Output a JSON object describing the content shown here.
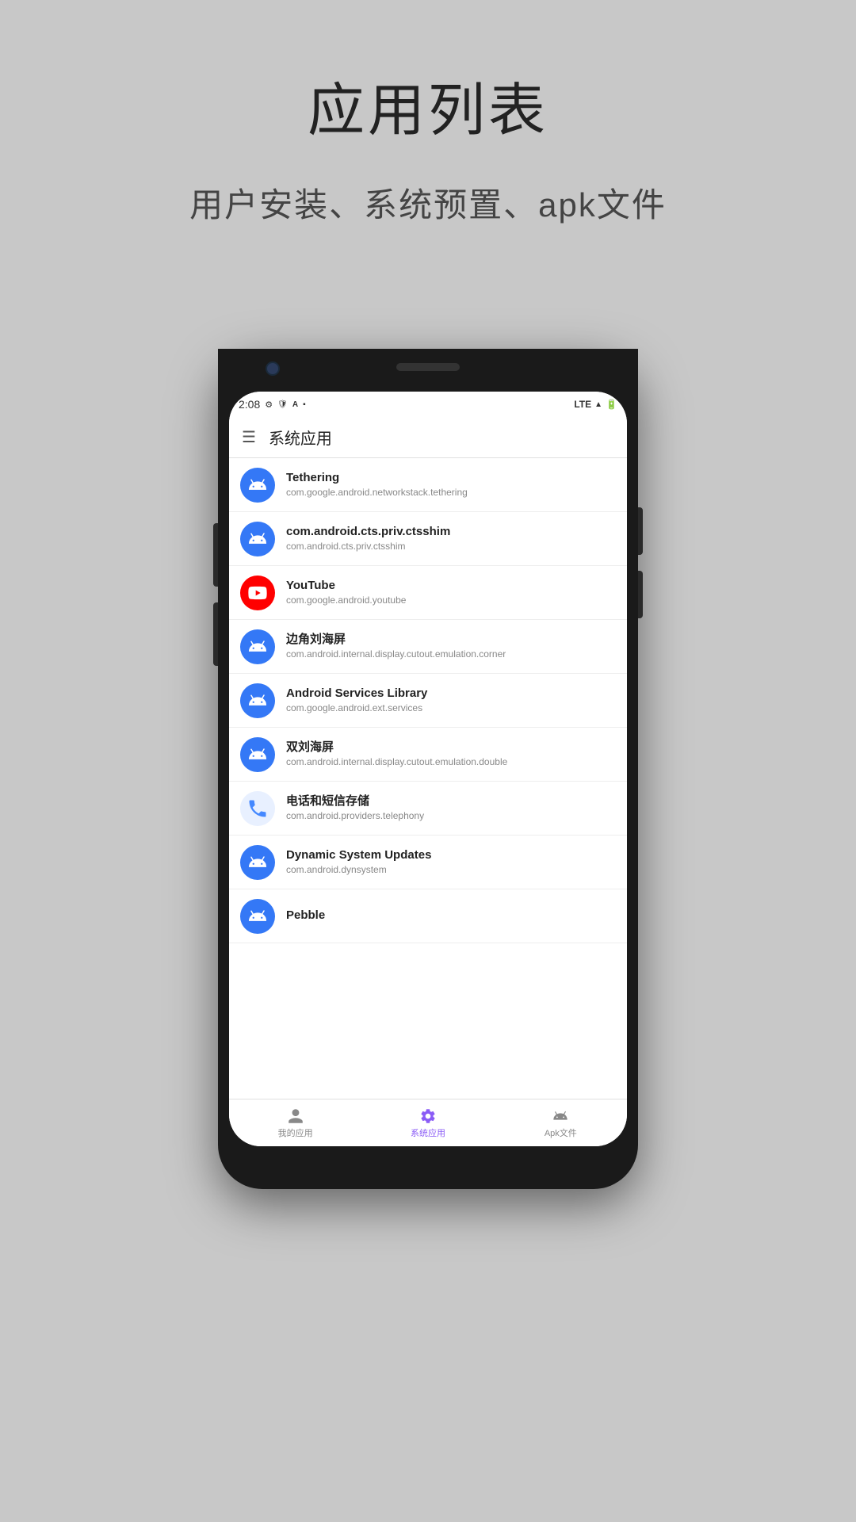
{
  "page": {
    "title": "应用列表",
    "subtitle": "用户安装、系统预置、apk文件"
  },
  "status_bar": {
    "time": "2:08",
    "lte": "LTE",
    "icons": [
      "gear",
      "shield",
      "a",
      "battery"
    ]
  },
  "app_bar": {
    "title": "系统应用"
  },
  "apps": [
    {
      "name": "Tethering",
      "package": "com.google.android.networkstack.tethering",
      "icon_type": "android_blue"
    },
    {
      "name": "com.android.cts.priv.ctsshim",
      "package": "com.android.cts.priv.ctsshim",
      "icon_type": "android_blue"
    },
    {
      "name": "YouTube",
      "package": "com.google.android.youtube",
      "icon_type": "youtube"
    },
    {
      "name": "边角刘海屏",
      "package": "com.android.internal.display.cutout.emulation.corner",
      "icon_type": "android_blue"
    },
    {
      "name": "Android Services Library",
      "package": "com.google.android.ext.services",
      "icon_type": "android_blue"
    },
    {
      "name": "双刘海屏",
      "package": "com.android.internal.display.cutout.emulation.double",
      "icon_type": "android_blue"
    },
    {
      "name": "电话和短信存储",
      "package": "com.android.providers.telephony",
      "icon_type": "phone"
    },
    {
      "name": "Dynamic System Updates",
      "package": "com.android.dynsystem",
      "icon_type": "android_blue"
    },
    {
      "name": "Pebble",
      "package": "",
      "icon_type": "android_blue"
    }
  ],
  "bottom_nav": {
    "items": [
      {
        "label": "我的应用",
        "icon": "person",
        "active": false
      },
      {
        "label": "系统应用",
        "icon": "gear",
        "active": true
      },
      {
        "label": "Apk文件",
        "icon": "android",
        "active": false
      }
    ]
  }
}
